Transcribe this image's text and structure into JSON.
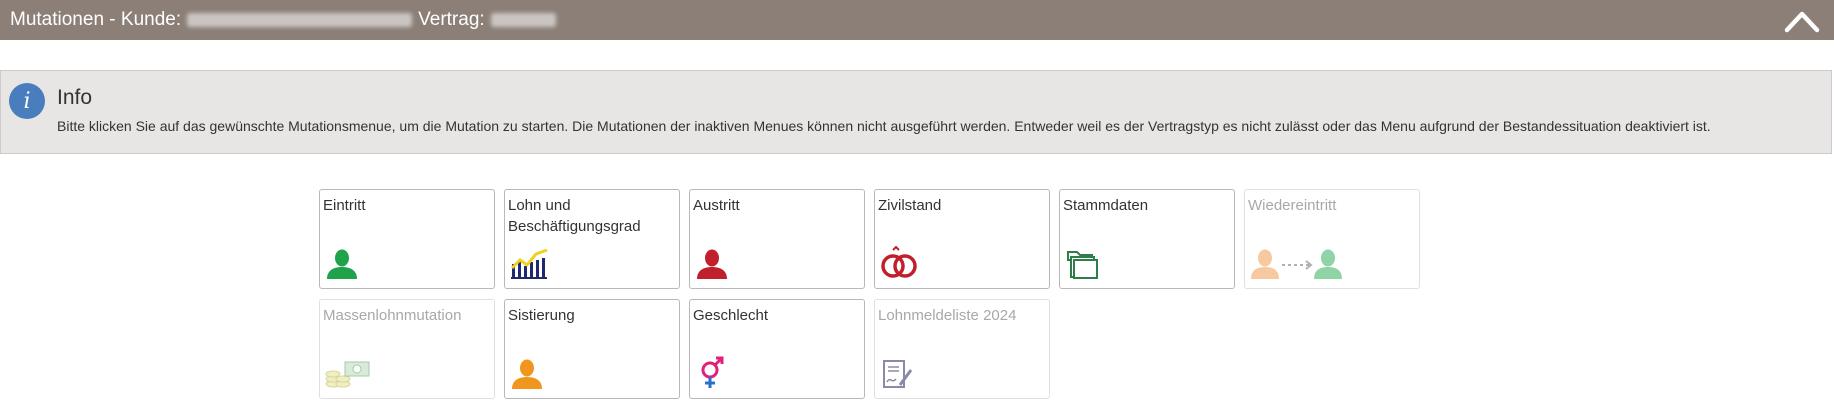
{
  "header": {
    "prefix": "Mutationen - Kunde:",
    "vertrag_label": "Vertrag:"
  },
  "info": {
    "title": "Info",
    "text": "Bitte klicken Sie auf das gewünschte Mutationsmenue, um die Mutation zu starten. Die Mutationen der inaktiven Menues können nicht ausgeführt werden. Entweder weil es der Vertragstyp es nicht zulässt oder das Menu aufgrund der Bestandessituation deaktiviert ist."
  },
  "tiles": [
    {
      "label": "Eintritt",
      "enabled": true,
      "icon": "person-icon"
    },
    {
      "label": "Lohn und Beschäftigungsgrad",
      "enabled": true,
      "icon": "salary-chart-icon"
    },
    {
      "label": "Austritt",
      "enabled": true,
      "icon": "person-icon"
    },
    {
      "label": "Zivilstand",
      "enabled": true,
      "icon": "rings-icon"
    },
    {
      "label": "Stammdaten",
      "enabled": true,
      "highlighted": true,
      "icon": "folder-icon"
    },
    {
      "label": "Wiedereintritt",
      "enabled": false,
      "icon": "re-entry-icon"
    },
    {
      "label": "Massenlohnmutation",
      "enabled": false,
      "icon": "money-icon"
    },
    {
      "label": "Sistierung",
      "enabled": true,
      "icon": "person-icon"
    },
    {
      "label": "Geschlecht",
      "enabled": true,
      "icon": "gender-icon"
    },
    {
      "label": "Lohnmeldeliste 2024",
      "enabled": false,
      "icon": "document-signature-icon"
    }
  ],
  "colors": {
    "header_bg": "#8c7f78",
    "info_icon": "#4a7dbd",
    "highlight": "#f3f03b",
    "eintritt": "#1fa24a",
    "austritt": "#c0202b",
    "sistierung": "#f0961e"
  }
}
